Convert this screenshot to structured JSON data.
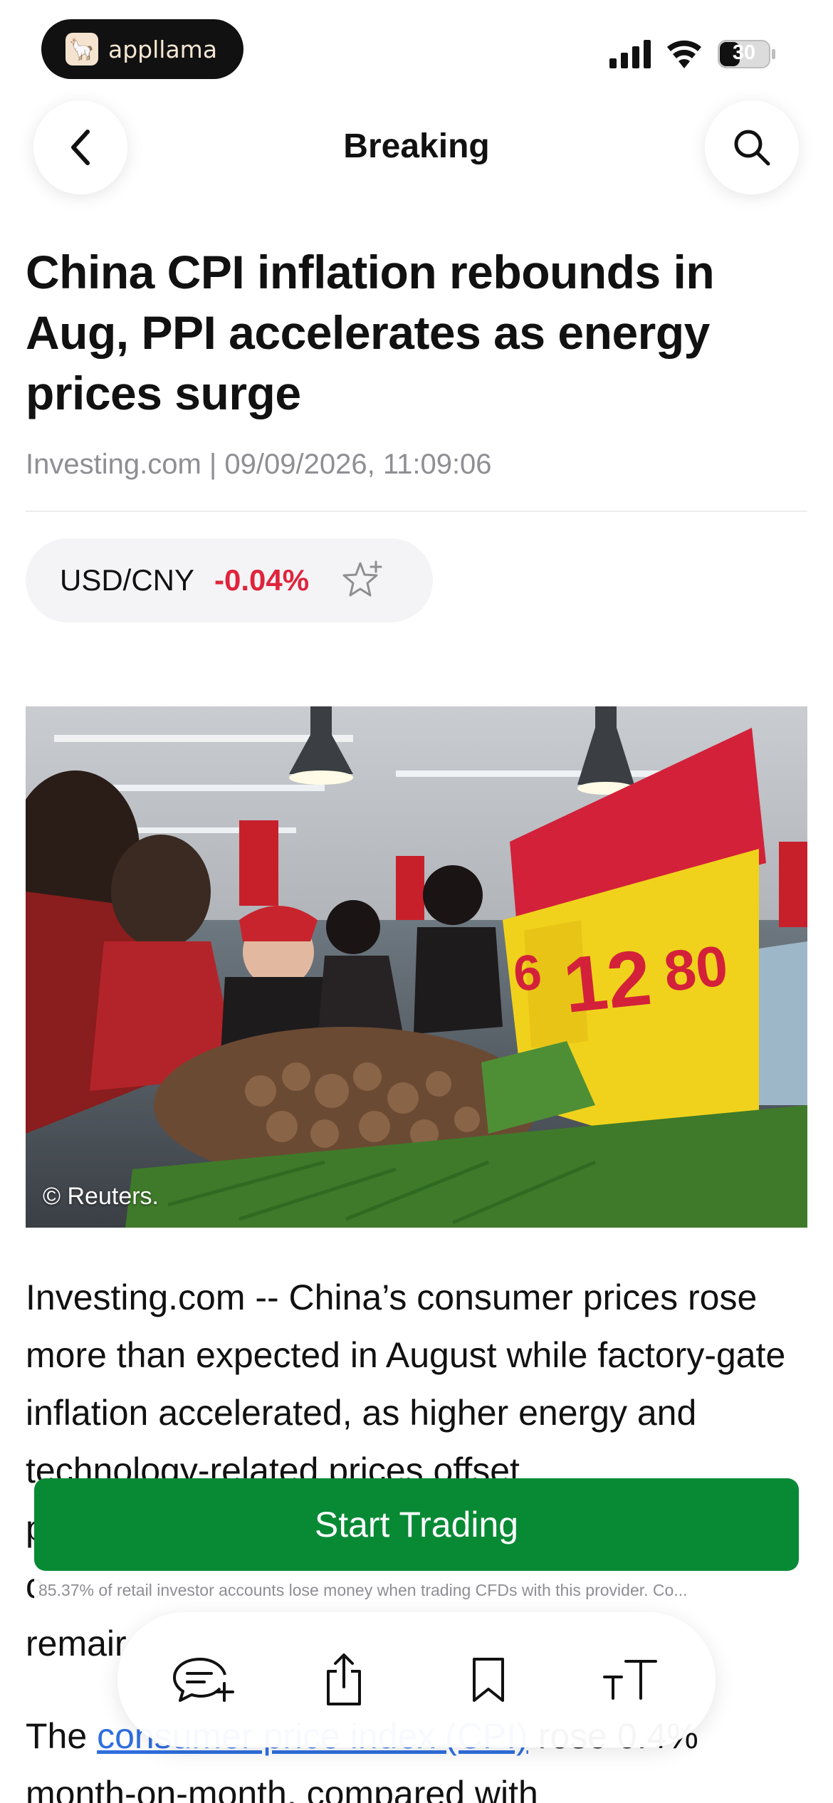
{
  "status_bar": {
    "app_pill_label": "appllama",
    "battery_level": "30"
  },
  "nav": {
    "title": "Breaking",
    "back_icon": "chevron-left-icon",
    "search_icon": "search-icon"
  },
  "article": {
    "headline": "China CPI inflation rebounds in Aug, PPI accelerates as energy prices surge",
    "meta": "Investing.com | 09/09/2026, 11:09:06",
    "instrument": {
      "symbol": "USD/CNY",
      "change": "-0.04%",
      "change_color": "#e0233c",
      "star_icon": "star-add-icon"
    },
    "image_credit": "© Reuters.",
    "paragraph1": "Investing.com -- China’s consumer prices rose more than expected in August while factory-gate inflation accelerated, as higher energy and technology-related prices offset",
    "paragraph1_line5_start": "p",
    "paragraph1_line6_start": "c",
    "paragraph1_line7_start": "remair",
    "paragraph2_before": "The ",
    "paragraph2_link": "consumer price index (CPI)",
    "paragraph2_after": " rose 0.4% month-on-month, compared with"
  },
  "cta": {
    "button_label": "Start Trading",
    "button_color": "#088a35",
    "disclaimer": "85.37% of retail investor accounts lose money when trading CFDs with this provider. Co..."
  },
  "toolbar": {
    "comment_icon": "add-comment-icon",
    "share_icon": "share-icon",
    "bookmark_icon": "bookmark-icon",
    "text_size_icon": "text-size-icon"
  }
}
